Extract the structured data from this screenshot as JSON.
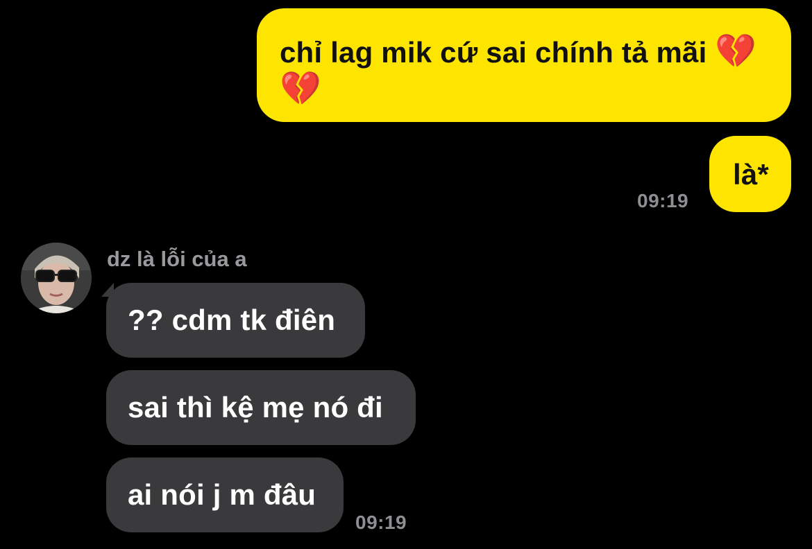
{
  "colors": {
    "background": "#000000",
    "outgoing_bubble": "#FEE500",
    "incoming_bubble": "#3A3A3C",
    "timestamp": "#8E8E93",
    "broken_heart": "#E0245E"
  },
  "messages_out": [
    {
      "text": "chỉ lag mik cứ sai chính tả mãi ",
      "emoji_1": "💔",
      "emoji_2": "💔",
      "emoji_icon": "broken-heart-icon"
    },
    {
      "text": "là*",
      "time": "09:19"
    }
  ],
  "incoming": {
    "sender_name": "dz là lỗi của a",
    "avatar_icon": "user-avatar-photo",
    "messages": [
      {
        "text": "?? cdm tk điên"
      },
      {
        "text": "sai thì kệ mẹ nó đi"
      },
      {
        "text": "ai nói j m đâu"
      }
    ],
    "time": "09:19"
  }
}
